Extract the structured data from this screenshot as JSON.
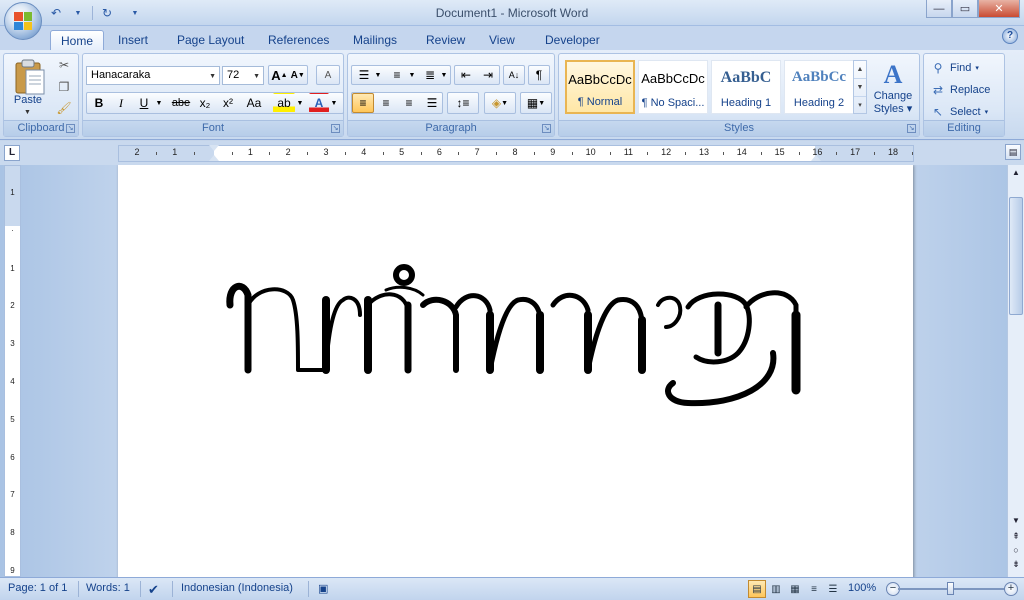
{
  "window": {
    "title": "Document1 - Microsoft Word",
    "controls": {
      "minimize": "—",
      "maximize": "▭",
      "close": "✕"
    }
  },
  "qat": {
    "undo_icon": "undo-icon",
    "redo_icon": "redo-icon",
    "customize_icon": "customize-qat-icon"
  },
  "tabs": [
    "Home",
    "Insert",
    "Page Layout",
    "References",
    "Mailings",
    "Review",
    "View",
    "Developer"
  ],
  "active_tab": "Home",
  "help_label": "?",
  "clipboard": {
    "paste_label": "Paste",
    "group_label": "Clipboard"
  },
  "font": {
    "name": "Hanacaraka",
    "size": "72",
    "group_label": "Font",
    "grow_label": "A",
    "shrink_label": "A",
    "clear_label": "A",
    "bold": "B",
    "italic": "I",
    "underline": "U",
    "strikethrough": "abe",
    "subscript": "x₂",
    "superscript": "x²",
    "change_case": "Aa",
    "highlight": "ab",
    "font_color": "A"
  },
  "paragraph": {
    "group_label": "Paragraph",
    "sort_label": "A↓",
    "pilcrow": "¶"
  },
  "styles": {
    "group_label": "Styles",
    "items": [
      {
        "sample": "AaBbCcDc",
        "name": "¶ Normal"
      },
      {
        "sample": "AaBbCcDc",
        "name": "¶ No Spaci..."
      },
      {
        "sample": "AaBbC",
        "name": "Heading 1"
      },
      {
        "sample": "AaBbCc",
        "name": "Heading 2"
      }
    ],
    "change_styles_line1": "Change",
    "change_styles_line2": "Styles"
  },
  "editing": {
    "group_label": "Editing",
    "find": "Find",
    "replace": "Replace",
    "select": "Select"
  },
  "ruler": {
    "h_numbers": [
      "2",
      "1",
      "",
      "1",
      "2",
      "3",
      "4",
      "5",
      "6",
      "7",
      "8",
      "9",
      "10",
      "11",
      "12",
      "13",
      "14",
      "15",
      "16",
      "17",
      "18"
    ],
    "v_numbers": [
      "1",
      "",
      "1",
      "2",
      "3",
      "4",
      "5",
      "6",
      "7",
      "8",
      "9"
    ]
  },
  "document": {
    "content_description": "Javanese script text rendered in Hanacaraka font at 72pt"
  },
  "status": {
    "page": "Page: 1 of 1",
    "words": "Words: 1",
    "language": "Indonesian (Indonesia)",
    "zoom": "100%"
  },
  "colors": {
    "accent": "#15428b",
    "ribbon_bg": "#dbe7f6",
    "active_highlight": "#ffc659"
  }
}
